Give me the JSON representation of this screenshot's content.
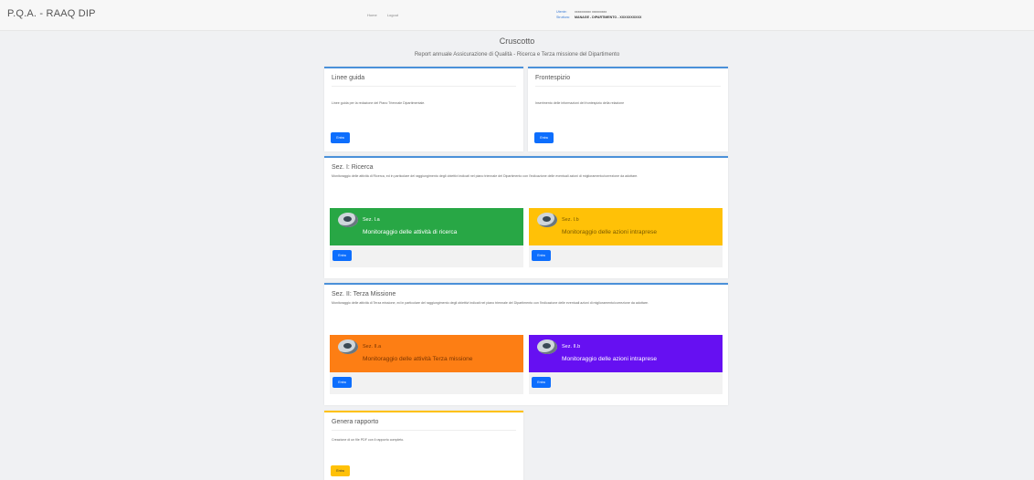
{
  "app": {
    "brand": "P.Q.A. - RAAQ DIP",
    "nav": [
      "Home",
      "Logout"
    ],
    "user": {
      "label1": "Utente:",
      "value1": "xxxxxxxxxx xxxxxxxxx",
      "label2": "Struttura:",
      "value2": "MANAGE - DIPARTIMENTO - XXXXXXXXXX"
    }
  },
  "header": {
    "title": "Cruscotto",
    "subtitle": "Report annuale Assicurazione di Qualità - Ricerca e Terza missione del Dipartimento"
  },
  "cards": {
    "linee_guida": {
      "title": "Linee guida",
      "text": "Linee guida per la redazione del Piano Triennale Dipartimentale.",
      "button": "Entra"
    },
    "frontespizio": {
      "title": "Frontespizio",
      "text": "Inserimento delle informazioni del frontespizio della relazione",
      "button": "Entra"
    },
    "ricerca": {
      "title": "Sez. I: Ricerca",
      "text": "Monitoraggio delle attività di Ricerca, ed in particolare del raggiungimento degli obiettivi indicati nel piano triennale del Dipartimento con l'indicazione delle eventuali azioni di miglioramento/correzione da adottare.",
      "tiles": [
        {
          "code": "Sez. I.a",
          "label": "Monitoraggio delle attività di ricerca",
          "button": "Entra",
          "color": "#28a745"
        },
        {
          "code": "Sez. I.b",
          "label": "Monitoraggio delle azioni intraprese",
          "button": "Entra",
          "color": "#ffc107"
        }
      ]
    },
    "terza": {
      "title": "Sez. II: Terza Missione",
      "text": "Monitoraggio delle attività di Terza missione, ed in particolare del raggiungimento degli obiettivi indicati nel piano triennale del Dipartimento con l'indicazione delle eventuali azioni di miglioramento/correzione da adottare.",
      "tiles": [
        {
          "code": "Sez. II.a",
          "label": "Monitoraggio delle attività Terza missione",
          "button": "Entra",
          "color": "#fd7e14"
        },
        {
          "code": "Sez. II.b",
          "label": "Monitoraggio delle azioni intraprese",
          "button": "Entra",
          "color": "#6610f2"
        }
      ]
    },
    "genera": {
      "title": "Genera rapporto",
      "text": "Creazione di un file PDF con il rapporto completo.",
      "button": "Entra"
    }
  }
}
